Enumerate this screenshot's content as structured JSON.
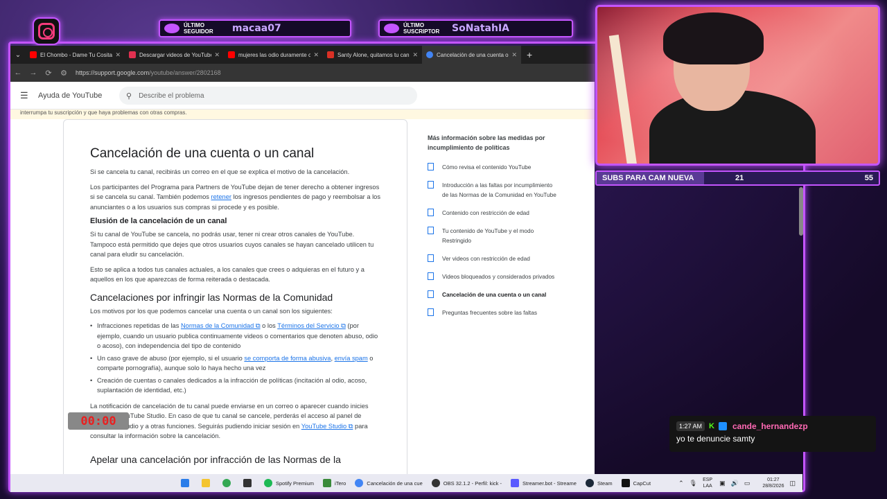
{
  "overlay": {
    "last_follower_label": "ÚLTIMO SEGUIDOR",
    "last_follower": "macaa07",
    "last_sub_label": "ÚLTIMO SUSCRIPTOR",
    "last_sub": "SoNatahIA"
  },
  "browser": {
    "tabs": [
      {
        "label": "El Chombo - Dame Tu Cosita (Ch",
        "icon": "youtube-icon",
        "color": "#ff0000"
      },
      {
        "label": "Descargar videos de YouTube -",
        "icon": "download-icon",
        "color": "#e03050"
      },
      {
        "label": "mujeres las odio duramente co",
        "icon": "youtube-icon",
        "color": "#ff0000"
      },
      {
        "label": "Santy Alone, quitamos tu canal",
        "icon": "mail-icon",
        "color": "#d93025"
      },
      {
        "label": "Cancelación de una cuenta o un",
        "icon": "google-icon",
        "color": "#4285f4"
      }
    ],
    "url_host": "https://support.google.com",
    "url_path": "/youtube/answer/2802168"
  },
  "help": {
    "site_title": "Ayuda de YouTube",
    "search_placeholder": "Describe el problema",
    "notice": "interrumpa tu suscripción y que haya problemas con otras compras.",
    "h1": "Cancelación de una cuenta o un canal",
    "p1": "Si se cancela tu canal, recibirás un correo en el que se explica el motivo de la cancelación.",
    "p2a": "Los participantes del Programa para Partners de YouTube dejan de tener derecho a obtener ingresos si se cancela su canal. También podemos ",
    "p2link": "retener",
    "p2b": " los ingresos pendientes de pago y reembolsar a los anunciantes o a los usuarios sus compras si procede y es posible.",
    "h3": "Elusión de la cancelación de un canal",
    "p3": "Si tu canal de YouTube se cancela, no podrás usar, tener ni crear otros canales de YouTube. Tampoco está permitido que dejes que otros usuarios cuyos canales se hayan cancelado utilicen tu canal para eludir su cancelación.",
    "p4": "Esto se aplica a todos tus canales actuales, a los canales que crees o adquieras en el futuro y a aquellos en los que aparezcas de forma reiterada o destacada.",
    "h2": "Cancelaciones por infringir las Normas de la Comunidad",
    "p5": "Los motivos por los que podemos cancelar una cuenta o un canal son los siguientes:",
    "li1a": "Infracciones repetidas de las ",
    "li1l1": "Normas de la Comunidad ⧉",
    "li1b": " o los ",
    "li1l2": "Términos del Servicio ⧉",
    "li1c": " (por ejemplo, cuando un usuario publica continuamente videos o comentarios que denoten abuso, odio o acoso), con independencia del tipo de contenido",
    "li2a": "Un caso grave de abuso (por ejemplo, si el usuario ",
    "li2l1": "se comporta de forma abusiva",
    "li2b": ", ",
    "li2l2": "envía spam",
    "li2c": " o comparte pornografía), aunque solo lo haya hecho una vez",
    "li3": "Creación de cuentas o canales dedicados a la infracción de políticas (incitación al odio, acoso, suplantación de identidad, etc.)",
    "p6a": "La notificación de cancelación de tu canal puede enviarse en un correo o aparecer cuando inicies sesión en YouTube Studio. En caso de que tu canal se cancele, perderás el acceso al panel de control de Studio y a otras funciones. Seguirás pudiendo iniciar sesión en ",
    "p6l": "YouTube Studio ⧉",
    "p6b": " para consultar la información sobre la cancelación.",
    "h2b": "Apelar una cancelación por infracción de las Normas de la",
    "side_title": "Más información sobre las medidas por incumplimiento de políticas",
    "side": [
      "Cómo revisa el contenido YouTube",
      "Introducción a las faltas por incumplimiento de las Normas de la Comunidad en YouTube",
      "Contenido con restricción de edad",
      "Tu contenido de YouTube y el modo Restringido",
      "Ver videos con restricción de edad",
      "Videos bloqueados y considerados privados",
      "Cancelación de una cuenta o un canal",
      "Preguntas frecuentes sobre las faltas"
    ]
  },
  "subs_bar": {
    "label": "SUBS PARA CAM NUEVA",
    "current": "21",
    "goal": "55",
    "progress": 0.38
  },
  "timer": "00:00",
  "chat": {
    "time": "1:27 AM",
    "user": "cande_hernandezp",
    "message": "yo te denuncie samty"
  },
  "taskbar": {
    "apps": [
      {
        "label": "Spotify Premium",
        "color": "#1db954"
      },
      {
        "label": "iTero",
        "color": "#3a8a3a"
      },
      {
        "label": "Cancelación de una cue",
        "color": "#4285f4"
      },
      {
        "label": "OBS 32.1.2 - Perfil: kick -",
        "color": "#333"
      },
      {
        "label": "Streamer.bot - Streame",
        "color": "#5a5aff"
      },
      {
        "label": "Steam",
        "color": "#1b2838"
      },
      {
        "label": "CapCut",
        "color": "#111"
      }
    ],
    "lang1": "ESP",
    "lang2": "LAA",
    "time": "01:27",
    "date": "28/8/2026"
  }
}
